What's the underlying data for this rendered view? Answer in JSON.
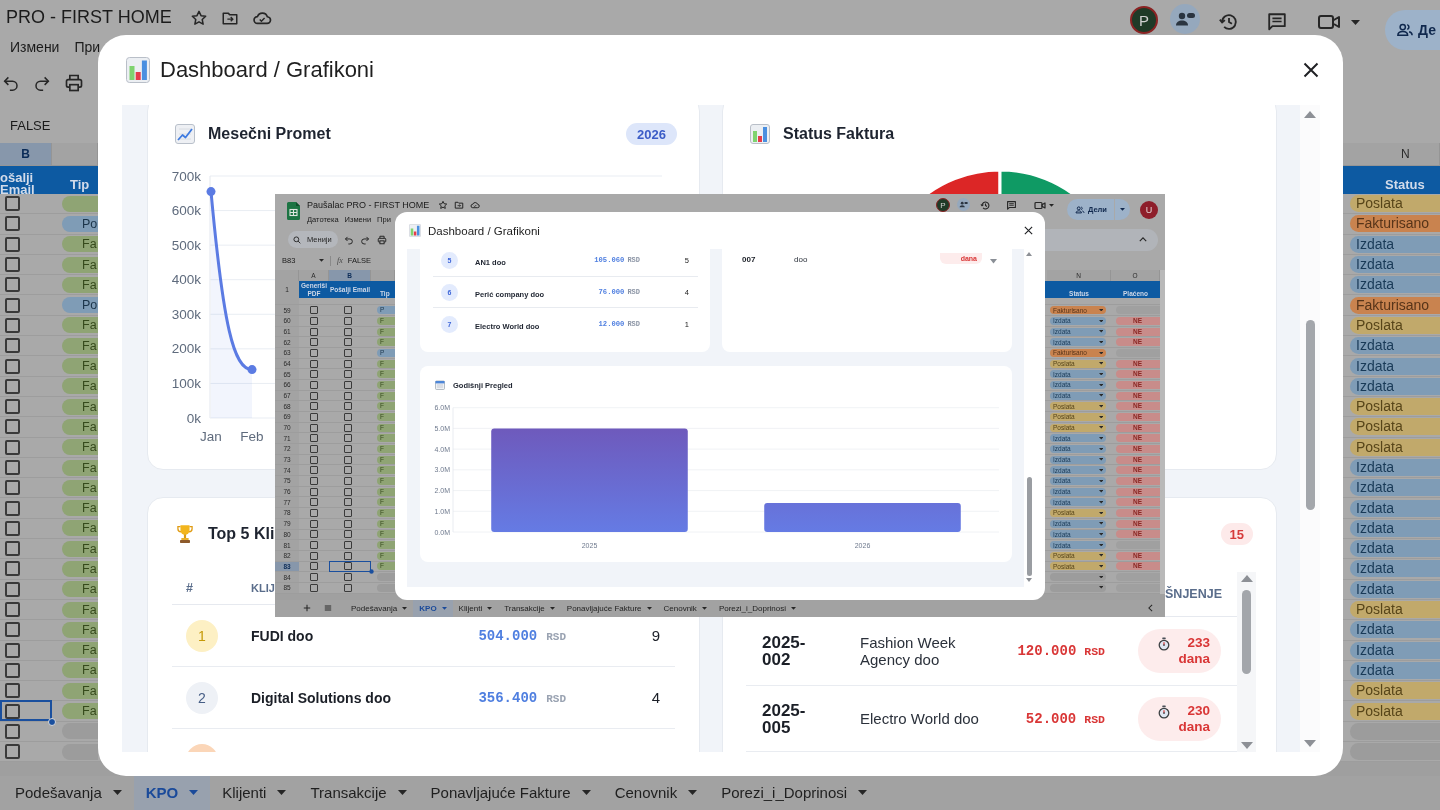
{
  "background_sheet": {
    "title": "PRO - FIRST HOME",
    "account_avatar": "P",
    "share_button": "Де",
    "menu": [
      {
        "label": "Измени"
      },
      {
        "label": "При"
      }
    ],
    "formula": "FALSE",
    "column_letters": [
      {
        "label": "B",
        "selected": true
      },
      {
        "label": "N",
        "selected": false
      }
    ],
    "headers": [
      {
        "label": "ošalji Email"
      },
      {
        "label": "Tip"
      },
      {
        "label": "Status"
      }
    ],
    "rows": [
      {
        "checked": false,
        "selected": false,
        "type": {
          "color": "#8fa474"
        },
        "status": {
          "label": "Poslata",
          "color": "#c1a96b"
        }
      },
      {
        "checked": false,
        "selected": false,
        "type": {
          "label": "Po",
          "color": "#7f9cb6"
        },
        "status": {
          "label": "Fakturisano",
          "color": "#c9834f"
        }
      },
      {
        "checked": false,
        "selected": false,
        "type": {
          "label": "Fa",
          "color": "#8fa474"
        },
        "status": {
          "label": "Izdata",
          "color": "#7f9cb6"
        }
      },
      {
        "checked": false,
        "selected": false,
        "type": {
          "label": "Fa",
          "color": "#8fa474"
        },
        "status": {
          "label": "Izdata",
          "color": "#7f9cb6"
        }
      },
      {
        "checked": false,
        "selected": false,
        "type": {
          "label": "Fa",
          "color": "#8fa474"
        },
        "status": {
          "label": "Izdata",
          "color": "#7f9cb6"
        }
      },
      {
        "checked": false,
        "selected": false,
        "type": {
          "label": "Po",
          "color": "#7f9cb6"
        },
        "status": {
          "label": "Fakturisano",
          "color": "#c9834f"
        }
      },
      {
        "checked": false,
        "selected": false,
        "type": {
          "label": "Fa",
          "color": "#8fa474"
        },
        "status": {
          "label": "Poslata",
          "color": "#c1a96b"
        }
      },
      {
        "checked": false,
        "selected": false,
        "type": {
          "label": "Fa",
          "color": "#8fa474"
        },
        "status": {
          "label": "Izdata",
          "color": "#7f9cb6"
        }
      },
      {
        "checked": false,
        "selected": false,
        "type": {
          "label": "Fa",
          "color": "#8fa474"
        },
        "status": {
          "label": "Izdata",
          "color": "#7f9cb6"
        }
      },
      {
        "checked": false,
        "selected": false,
        "type": {
          "label": "Fa",
          "color": "#8fa474"
        },
        "status": {
          "label": "Izdata",
          "color": "#7f9cb6"
        }
      },
      {
        "checked": false,
        "selected": false,
        "type": {
          "label": "Fa",
          "color": "#8fa474"
        },
        "status": {
          "label": "Poslata",
          "color": "#c1a96b"
        }
      },
      {
        "checked": false,
        "selected": false,
        "type": {
          "label": "Fa",
          "color": "#8fa474"
        },
        "status": {
          "label": "Poslata",
          "color": "#c1a96b"
        }
      },
      {
        "checked": false,
        "selected": false,
        "type": {
          "label": "Fa",
          "color": "#8fa474"
        },
        "status": {
          "label": "Poslata",
          "color": "#c1a96b"
        }
      },
      {
        "checked": false,
        "selected": false,
        "type": {
          "label": "Fa",
          "color": "#8fa474"
        },
        "status": {
          "label": "Izdata",
          "color": "#7f9cb6"
        }
      },
      {
        "checked": false,
        "selected": false,
        "type": {
          "label": "Fa",
          "color": "#8fa474"
        },
        "status": {
          "label": "Izdata",
          "color": "#7f9cb6"
        }
      },
      {
        "checked": false,
        "selected": false,
        "type": {
          "label": "Fa",
          "color": "#8fa474"
        },
        "status": {
          "label": "Izdata",
          "color": "#7f9cb6"
        }
      },
      {
        "checked": false,
        "selected": false,
        "type": {
          "label": "Fa",
          "color": "#8fa474"
        },
        "status": {
          "label": "Izdata",
          "color": "#7f9cb6"
        }
      },
      {
        "checked": false,
        "selected": false,
        "type": {
          "label": "Fa",
          "color": "#8fa474"
        },
        "status": {
          "label": "Izdata",
          "color": "#7f9cb6"
        }
      },
      {
        "checked": false,
        "selected": false,
        "type": {
          "label": "Fa",
          "color": "#8fa474"
        },
        "status": {
          "label": "Izdata",
          "color": "#7f9cb6"
        }
      },
      {
        "checked": false,
        "selected": false,
        "type": {
          "label": "Fa",
          "color": "#8fa474"
        },
        "status": {
          "label": "Izdata",
          "color": "#7f9cb6"
        }
      },
      {
        "checked": false,
        "selected": false,
        "type": {
          "label": "Fa",
          "color": "#8fa474"
        },
        "status": {
          "label": "Poslata",
          "color": "#c1a96b"
        }
      },
      {
        "checked": false,
        "selected": false,
        "type": {
          "label": "Fa",
          "color": "#8fa474"
        },
        "status": {
          "label": "Izdata",
          "color": "#7f9cb6"
        }
      },
      {
        "checked": false,
        "selected": false,
        "type": {
          "label": "Fa",
          "color": "#8fa474"
        },
        "status": {
          "label": "Izdata",
          "color": "#7f9cb6"
        }
      },
      {
        "checked": false,
        "selected": false,
        "type": {
          "label": "Fa",
          "color": "#8fa474"
        },
        "status": {
          "label": "Izdata",
          "color": "#7f9cb6"
        }
      },
      {
        "checked": false,
        "selected": false,
        "type": {
          "label": "Fa",
          "color": "#8fa474"
        },
        "status": {
          "label": "Poslata",
          "color": "#c1a96b"
        }
      },
      {
        "checked": false,
        "selected": true,
        "type": {
          "label": "Fa",
          "color": "#8fa474"
        },
        "status": {
          "label": "Poslata",
          "color": "#c1a96b"
        }
      },
      {
        "checked": false,
        "selected": false,
        "type": {
          "color": "#9c9c9c"
        },
        "status": {
          "color": "#9c9c9c"
        }
      },
      {
        "checked": false,
        "selected": false,
        "type": {
          "color": "#9c9c9c"
        },
        "status": {
          "color": "#9c9c9c"
        }
      }
    ],
    "sheet_tabs": [
      {
        "label": "Podešavanja",
        "selected": false
      },
      {
        "label": "KPO",
        "selected": true
      },
      {
        "label": "Klijenti",
        "selected": false
      },
      {
        "label": "Transakcije",
        "selected": false
      },
      {
        "label": "Ponavljajuće Fakture",
        "selected": false
      },
      {
        "label": "Cenovnik",
        "selected": false
      },
      {
        "label": "Porezi_i_Doprinosi",
        "selected": false
      }
    ]
  },
  "dashboard_dialog": {
    "title": "Dashboard / Grafikoni",
    "monthly_card": {
      "year_badge": "2026",
      "chart_data": {
        "type": "area",
        "title": "Mesečni Promet",
        "categories": [
          "Jan",
          "Feb"
        ],
        "values": [
          655000,
          140000
        ],
        "ylim": [
          0,
          700000
        ],
        "yticks": [
          {
            "value": 0,
            "label": "0k"
          },
          {
            "value": 100000,
            "label": "100k"
          },
          {
            "value": 200000,
            "label": "200k"
          },
          {
            "value": 300000,
            "label": "300k"
          },
          {
            "value": 400000,
            "label": "400k"
          },
          {
            "value": 500000,
            "label": "500k"
          },
          {
            "value": 600000,
            "label": "600k"
          },
          {
            "value": 700000,
            "label": "700k"
          }
        ],
        "grid": true,
        "marker": "circle"
      }
    },
    "status_card": {
      "title": "Status Faktura"
    },
    "top_clients_card": {
      "title": "Top 5 Kli",
      "columns": [
        "#",
        "KLIJ"
      ],
      "rows": [
        {
          "rank": "1",
          "color": "#fdf0c4",
          "name": "FUDI doo",
          "amount": "504.000",
          "currency": "RSD",
          "count": "9"
        },
        {
          "rank": "2",
          "color": "#eef1f6",
          "name": "Digital Solutions doo",
          "amount": "356.400",
          "currency": "RSD",
          "count": "4"
        },
        {
          "color": "#fbd6b8"
        }
      ]
    },
    "overdue_card": {
      "count_badge": "15",
      "columns": [
        "ŠNJENJE"
      ],
      "rows": [
        {
          "number": "2025-002",
          "client": "Fashion Week Agency doo",
          "amount": "120.000",
          "currency": "RSD",
          "days": "233 dana"
        },
        {
          "number": "2025-005",
          "client": "Electro World doo",
          "amount": "52.000",
          "currency": "RSD",
          "days": "230 dana"
        }
      ]
    }
  },
  "embedded_screenshot": {
    "title": "Paušalac PRO - FIRST HOME",
    "menu": [
      {
        "label": "Датотека"
      },
      {
        "label": "Измени"
      },
      {
        "label": "При"
      }
    ],
    "account_avatar": "P",
    "share_button": "Дели",
    "user_avatar": "U",
    "search": {
      "placeholder": "Менији"
    },
    "cell_reference": "B83",
    "formula_icon": "fx",
    "formula": "FALSE",
    "column_letters": [
      {
        "label": "A",
        "selected": false
      },
      {
        "label": "B",
        "selected": true
      },
      {
        "label": "N",
        "selected": false
      },
      {
        "label": "O",
        "selected": false
      }
    ],
    "header_row_number": "1",
    "headers": [
      {
        "label": "Generiši PDF"
      },
      {
        "label": "Pošalji Email"
      },
      {
        "label": "Tip"
      },
      {
        "label": "Status"
      },
      {
        "label": "Plaćeno"
      }
    ],
    "rows": [
      {
        "number": "59",
        "pdf_checked": false,
        "email_checked": false,
        "selected": false,
        "type": {
          "label": "P",
          "color": "#7f9cb6"
        },
        "status": {
          "label": "Fakturisano",
          "color": "#c9834f"
        },
        "paid": {
          "color": "#a0a0a0"
        }
      },
      {
        "number": "60",
        "pdf_checked": false,
        "email_checked": false,
        "selected": false,
        "type": {
          "label": "F",
          "color": "#8fa474"
        },
        "status": {
          "label": "Izdata",
          "color": "#7f9cb6"
        },
        "paid": {
          "label": "NE",
          "color": "#c88c8a"
        }
      },
      {
        "number": "61",
        "pdf_checked": false,
        "email_checked": false,
        "selected": false,
        "type": {
          "label": "F",
          "color": "#8fa474"
        },
        "status": {
          "label": "Izdata",
          "color": "#7f9cb6"
        },
        "paid": {
          "label": "NE",
          "color": "#c88c8a"
        }
      },
      {
        "number": "62",
        "pdf_checked": false,
        "email_checked": false,
        "selected": false,
        "type": {
          "label": "F",
          "color": "#8fa474"
        },
        "status": {
          "label": "Izdata",
          "color": "#7f9cb6"
        },
        "paid": {
          "label": "NE",
          "color": "#c88c8a"
        }
      },
      {
        "number": "63",
        "pdf_checked": false,
        "email_checked": false,
        "selected": false,
        "type": {
          "label": "P",
          "color": "#7f9cb6"
        },
        "status": {
          "label": "Fakturisano",
          "color": "#c9834f"
        },
        "paid": {
          "color": "#a0a0a0"
        }
      },
      {
        "number": "64",
        "pdf_checked": false,
        "email_checked": false,
        "selected": false,
        "type": {
          "label": "F",
          "color": "#8fa474"
        },
        "status": {
          "label": "Poslata",
          "color": "#c1a96b"
        },
        "paid": {
          "label": "NE",
          "color": "#c88c8a"
        }
      },
      {
        "number": "65",
        "pdf_checked": false,
        "email_checked": false,
        "selected": false,
        "type": {
          "label": "F",
          "color": "#8fa474"
        },
        "status": {
          "label": "Izdata",
          "color": "#7f9cb6"
        },
        "paid": {
          "label": "NE",
          "color": "#c88c8a"
        }
      },
      {
        "number": "66",
        "pdf_checked": false,
        "email_checked": false,
        "selected": false,
        "type": {
          "label": "F",
          "color": "#8fa474"
        },
        "status": {
          "label": "Izdata",
          "color": "#7f9cb6"
        },
        "paid": {
          "label": "NE",
          "color": "#c88c8a"
        }
      },
      {
        "number": "67",
        "pdf_checked": false,
        "email_checked": false,
        "selected": false,
        "type": {
          "label": "F",
          "color": "#8fa474"
        },
        "status": {
          "label": "Izdata",
          "color": "#7f9cb6"
        },
        "paid": {
          "label": "NE",
          "color": "#c88c8a"
        }
      },
      {
        "number": "68",
        "pdf_checked": false,
        "email_checked": false,
        "selected": false,
        "type": {
          "label": "F",
          "color": "#8fa474"
        },
        "status": {
          "label": "Poslata",
          "color": "#c1a96b"
        },
        "paid": {
          "label": "NE",
          "color": "#c88c8a"
        }
      },
      {
        "number": "69",
        "pdf_checked": false,
        "email_checked": false,
        "selected": false,
        "type": {
          "label": "F",
          "color": "#8fa474"
        },
        "status": {
          "label": "Poslata",
          "color": "#c1a96b"
        },
        "paid": {
          "label": "NE",
          "color": "#c88c8a"
        }
      },
      {
        "number": "70",
        "pdf_checked": false,
        "email_checked": false,
        "selected": false,
        "type": {
          "label": "F",
          "color": "#8fa474"
        },
        "status": {
          "label": "Poslata",
          "color": "#c1a96b"
        },
        "paid": {
          "label": "NE",
          "color": "#c88c8a"
        }
      },
      {
        "number": "71",
        "pdf_checked": false,
        "email_checked": false,
        "selected": false,
        "type": {
          "label": "F",
          "color": "#8fa474"
        },
        "status": {
          "label": "Izdata",
          "color": "#7f9cb6"
        },
        "paid": {
          "label": "NE",
          "color": "#c88c8a"
        }
      },
      {
        "number": "72",
        "pdf_checked": false,
        "email_checked": false,
        "selected": false,
        "type": {
          "label": "F",
          "color": "#8fa474"
        },
        "status": {
          "label": "Izdata",
          "color": "#7f9cb6"
        },
        "paid": {
          "label": "NE",
          "color": "#c88c8a"
        }
      },
      {
        "number": "73",
        "pdf_checked": false,
        "email_checked": false,
        "selected": false,
        "type": {
          "label": "F",
          "color": "#8fa474"
        },
        "status": {
          "label": "Izdata",
          "color": "#7f9cb6"
        },
        "paid": {
          "label": "NE",
          "color": "#c88c8a"
        }
      },
      {
        "number": "74",
        "pdf_checked": false,
        "email_checked": false,
        "selected": false,
        "type": {
          "label": "F",
          "color": "#8fa474"
        },
        "status": {
          "label": "Izdata",
          "color": "#7f9cb6"
        },
        "paid": {
          "label": "NE",
          "color": "#c88c8a"
        }
      },
      {
        "number": "75",
        "pdf_checked": false,
        "email_checked": false,
        "selected": false,
        "type": {
          "label": "F",
          "color": "#8fa474"
        },
        "status": {
          "label": "Izdata",
          "color": "#7f9cb6"
        },
        "paid": {
          "label": "NE",
          "color": "#c88c8a"
        }
      },
      {
        "number": "76",
        "pdf_checked": false,
        "email_checked": false,
        "selected": false,
        "type": {
          "label": "F",
          "color": "#8fa474"
        },
        "status": {
          "label": "Izdata",
          "color": "#7f9cb6"
        },
        "paid": {
          "label": "NE",
          "color": "#c88c8a"
        }
      },
      {
        "number": "77",
        "pdf_checked": false,
        "email_checked": false,
        "selected": false,
        "type": {
          "label": "F",
          "color": "#8fa474"
        },
        "status": {
          "label": "Izdata",
          "color": "#7f9cb6"
        },
        "paid": {
          "label": "NE",
          "color": "#c88c8a"
        }
      },
      {
        "number": "78",
        "pdf_checked": false,
        "email_checked": false,
        "selected": false,
        "type": {
          "label": "F",
          "color": "#8fa474"
        },
        "status": {
          "label": "Poslata",
          "color": "#c1a96b"
        },
        "paid": {
          "label": "NE",
          "color": "#c88c8a"
        }
      },
      {
        "number": "79",
        "pdf_checked": false,
        "email_checked": false,
        "selected": false,
        "type": {
          "label": "F",
          "color": "#8fa474"
        },
        "status": {
          "label": "Izdata",
          "color": "#7f9cb6"
        },
        "paid": {
          "label": "NE",
          "color": "#c88c8a"
        }
      },
      {
        "number": "80",
        "pdf_checked": false,
        "email_checked": false,
        "selected": false,
        "type": {
          "label": "F",
          "color": "#8fa474"
        },
        "status": {
          "label": "Izdata",
          "color": "#7f9cb6"
        },
        "paid": {
          "label": "NE",
          "color": "#c88c8a"
        }
      },
      {
        "number": "81",
        "pdf_checked": false,
        "email_checked": false,
        "selected": false,
        "type": {
          "label": "F",
          "color": "#8fa474"
        },
        "status": {
          "label": "Izdata",
          "color": "#7f9cb6"
        },
        "paid": {
          "color": "#a0a0a0"
        }
      },
      {
        "number": "82",
        "pdf_checked": false,
        "email_checked": false,
        "selected": false,
        "type": {
          "label": "F",
          "color": "#8fa474"
        },
        "status": {
          "label": "Poslata",
          "color": "#c1a96b"
        },
        "paid": {
          "label": "NE",
          "color": "#c88c8a"
        }
      },
      {
        "number": "83",
        "pdf_checked": false,
        "email_checked": false,
        "selected": true,
        "type": {
          "label": "F",
          "color": "#8fa474"
        },
        "status": {
          "label": "Poslata",
          "color": "#c1a96b"
        },
        "paid": {
          "label": "NE",
          "color": "#c88c8a"
        }
      },
      {
        "number": "84",
        "pdf_checked": false,
        "email_checked": false,
        "selected": false,
        "type": {
          "color": "#9c9c9c"
        },
        "status": {
          "color": "#9c9c9c"
        },
        "paid": {
          "color": "#a0a0a0"
        }
      },
      {
        "number": "85",
        "pdf_checked": false,
        "email_checked": false,
        "selected": false,
        "type": {
          "color": "#9c9c9c"
        },
        "status": {
          "color": "#9c9c9c"
        },
        "paid": {
          "color": "#a0a0a0"
        }
      }
    ],
    "dialog": {
      "title": "Dashboard / Grafikoni",
      "top_clients_rows": [
        {
          "rank": "5",
          "name": "AN1 doo",
          "amount": "105.060",
          "currency": "RSD",
          "count": "5"
        },
        {
          "rank": "6",
          "name": "Perić company doo",
          "amount": "76.000",
          "currency": "RSD",
          "count": "4"
        },
        {
          "rank": "7",
          "name": "Electro World doo",
          "amount": "12.000",
          "currency": "RSD",
          "count": "1"
        }
      ],
      "overdue_rows": [
        {
          "number": "007",
          "client": "doo",
          "days": "dana"
        }
      ],
      "yearly_card": {
        "chart_data": {
          "type": "bar",
          "title": "Godišnji Pregled",
          "categories": [
            "2025",
            "2026"
          ],
          "values": [
            5000000,
            1400000
          ],
          "ylim": [
            0,
            6000000
          ],
          "yticks": [
            {
              "value": 0,
              "label": "0.0M"
            },
            {
              "value": 1000000,
              "label": "1.0M"
            },
            {
              "value": 2000000,
              "label": "2.0M"
            },
            {
              "value": 3000000,
              "label": "3.0M"
            },
            {
              "value": 4000000,
              "label": "4.0M"
            },
            {
              "value": 5000000,
              "label": "5.0M"
            },
            {
              "value": 6000000,
              "label": "6.0M"
            }
          ],
          "grid": true
        }
      }
    },
    "sheet_tabs": [
      {
        "label": "Podešavanja",
        "selected": false
      },
      {
        "label": "KPO",
        "selected": true
      },
      {
        "label": "Klijenti",
        "selected": false
      },
      {
        "label": "Transakcije",
        "selected": false
      },
      {
        "label": "Ponavljajuće Fakture",
        "selected": false
      },
      {
        "label": "Cenovnik",
        "selected": false
      },
      {
        "label": "Porezi_i_Doprinosi",
        "selected": false
      }
    ]
  }
}
